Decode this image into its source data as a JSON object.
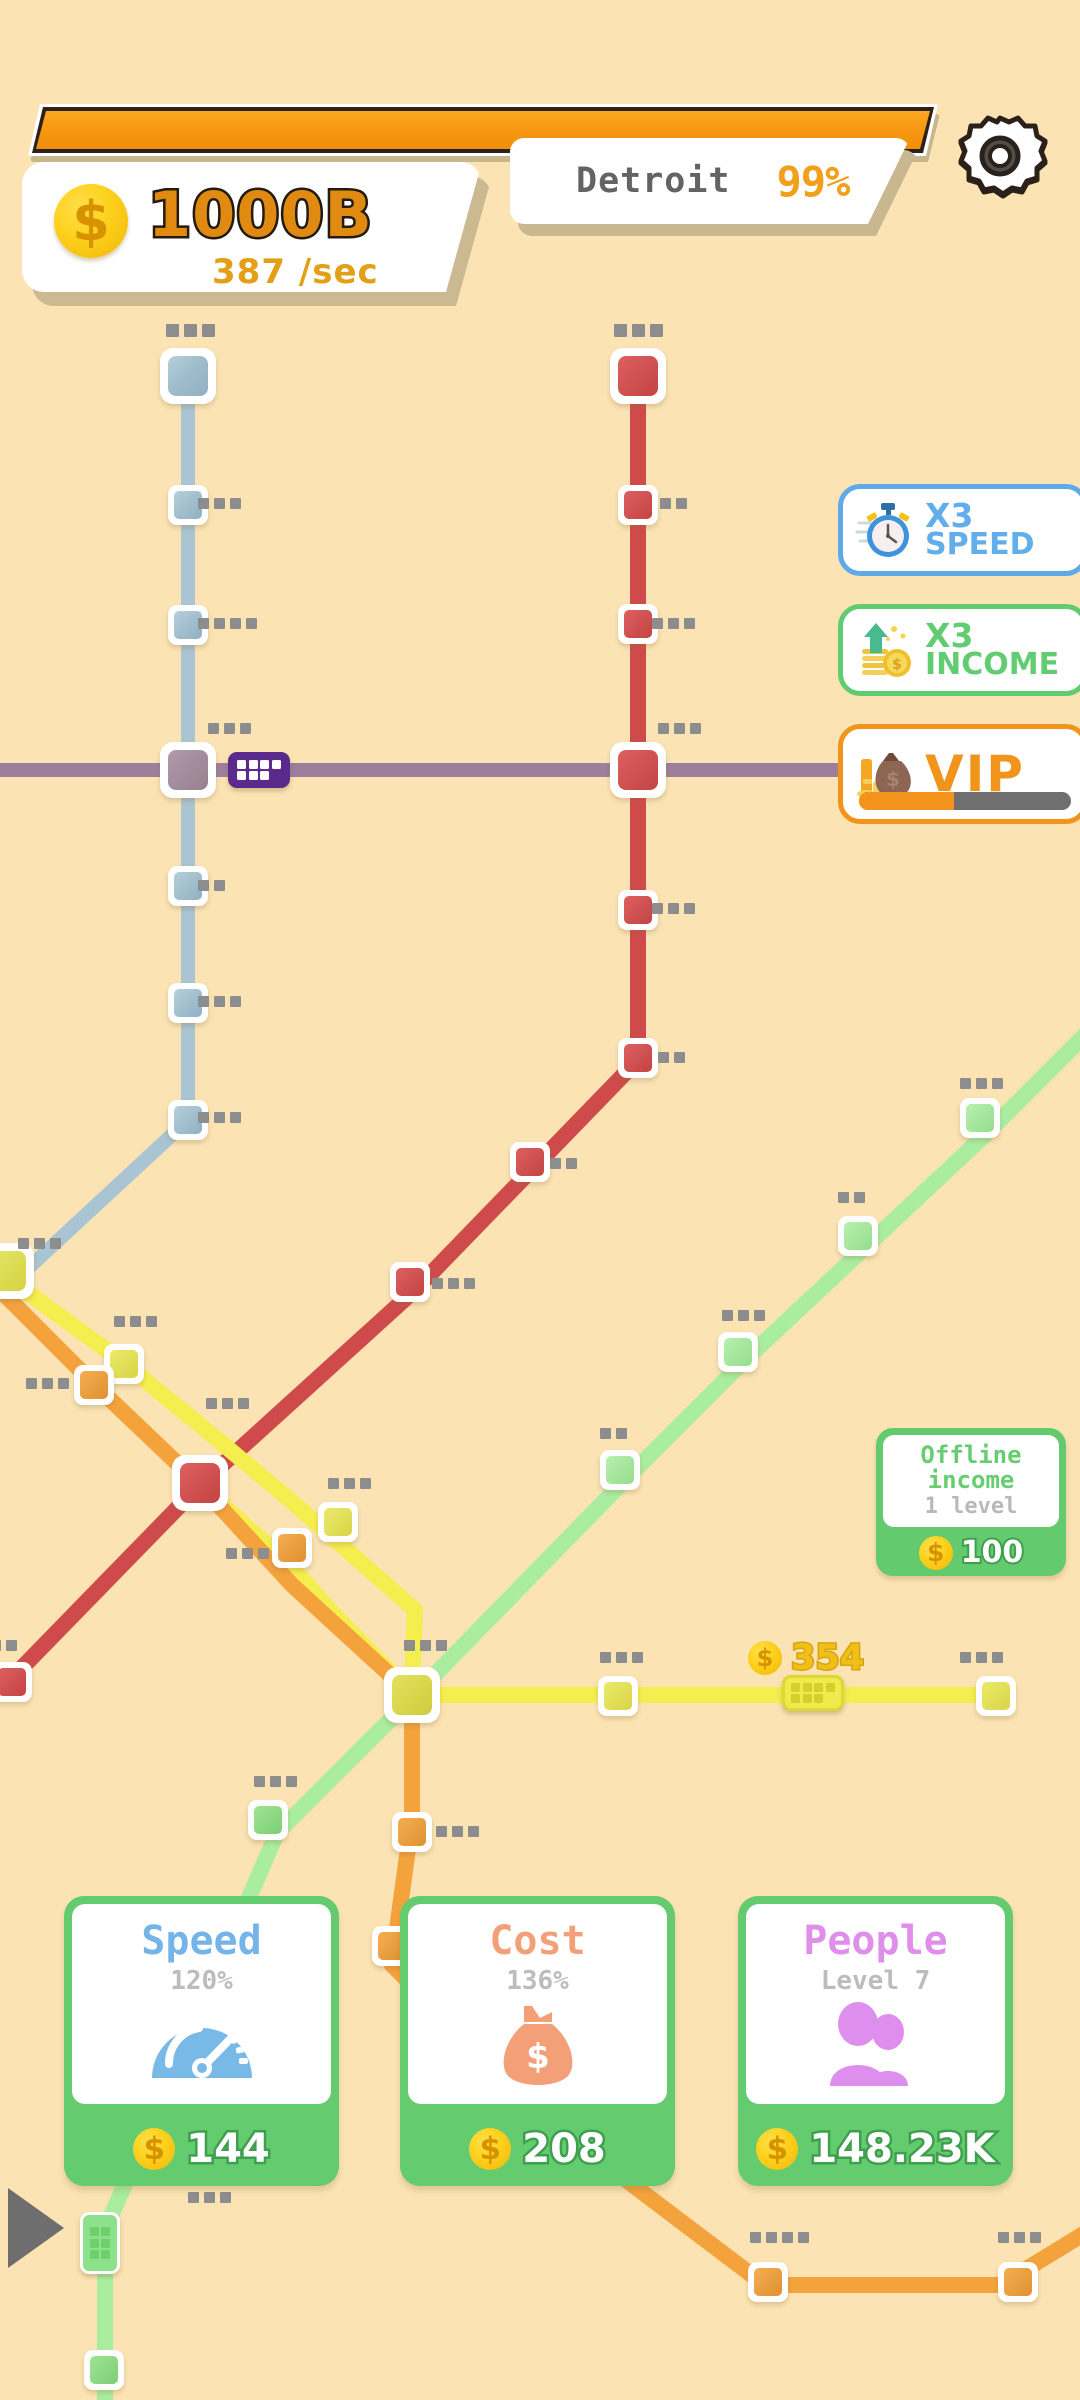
{
  "hud": {
    "progress": {
      "name": "city-progress-bar",
      "fill_percent": 100,
      "color": "#f79711"
    },
    "city": {
      "name": "Detroit",
      "percent": "99%"
    },
    "settings_icon": "gear-icon",
    "money": {
      "amount": "1000B",
      "rate": "387 /sec",
      "coin_symbol": "$"
    }
  },
  "boosts": [
    {
      "id": "speed",
      "icon": "stopwatch-icon",
      "line1": "X3",
      "line2": "SPEED",
      "color": "#5fa9e8"
    },
    {
      "id": "income",
      "icon": "coins-up-icon",
      "line1": "X3",
      "line2": "INCOME",
      "color": "#61cc6f"
    },
    {
      "id": "vip",
      "icon": "money-bag-icon",
      "label": "VIP",
      "color": "#f2941c",
      "bar_percent": 45
    }
  ],
  "offline_card": {
    "title_line1": "Offline",
    "title_line2": "income",
    "subtitle": "1 level",
    "price": "100"
  },
  "float_coin": {
    "value": "354"
  },
  "upgrades": [
    {
      "id": "speed",
      "title": "Speed",
      "sub": "120%",
      "icon": "speedometer-icon",
      "price": "144",
      "color": "#74b4e8"
    },
    {
      "id": "cost",
      "title": "Cost",
      "sub": "136%",
      "icon": "money-bag-icon",
      "price": "208",
      "color": "#f3a079"
    },
    {
      "id": "people",
      "title": "People",
      "sub": "Level 7",
      "icon": "people-icon",
      "price": "148.23K",
      "color": "#df8eea"
    }
  ],
  "play_button": {
    "name": "play-speed-toggle"
  },
  "map": {
    "background": "#fbe3b4",
    "lines": [
      {
        "id": "blue",
        "color": "#a9c4d2",
        "width": 13
      },
      {
        "id": "red",
        "color": "#cf4b4b",
        "width": 15
      },
      {
        "id": "purple",
        "color": "#9b7f9b",
        "width": 13
      },
      {
        "id": "yellow",
        "color": "#f5ee4f",
        "width": 15
      },
      {
        "id": "orange",
        "color": "#f4a33c",
        "width": 15
      },
      {
        "id": "green",
        "color": "#aaeda1",
        "width": 15
      }
    ],
    "trains": [
      {
        "line": "purple",
        "color": "#5b2a8c"
      },
      {
        "line": "yellow",
        "color": "#f5ee4f"
      },
      {
        "line": "green",
        "color": "#8de18a"
      }
    ]
  }
}
